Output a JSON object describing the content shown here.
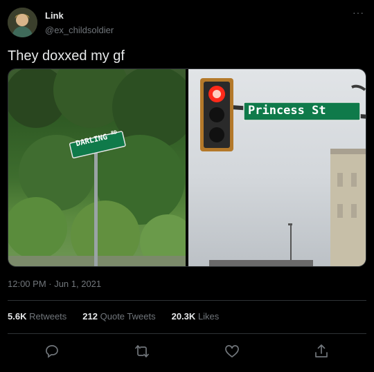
{
  "tweet": {
    "display_name": "Link",
    "handle": "@ex_childsoldier",
    "text": "They doxxed my gf",
    "timestamp": "12:00 PM · Jun 1, 2021",
    "more_label": "···"
  },
  "media": {
    "left_sign": {
      "main": "DARLING",
      "suffix": "RD"
    },
    "right_sign": "Princess St"
  },
  "stats": {
    "retweets_count": "5.6K",
    "retweets_label": "Retweets",
    "quotes_count": "212",
    "quotes_label": "Quote Tweets",
    "likes_count": "20.3K",
    "likes_label": "Likes"
  },
  "icons": [
    "reply-icon",
    "retweet-icon",
    "like-icon",
    "share-icon"
  ],
  "colors": {
    "background": "#000000",
    "text": "#e7e9ea",
    "muted": "#71767b",
    "divider": "#2f3336",
    "sign_green": "#0f7a4a"
  }
}
